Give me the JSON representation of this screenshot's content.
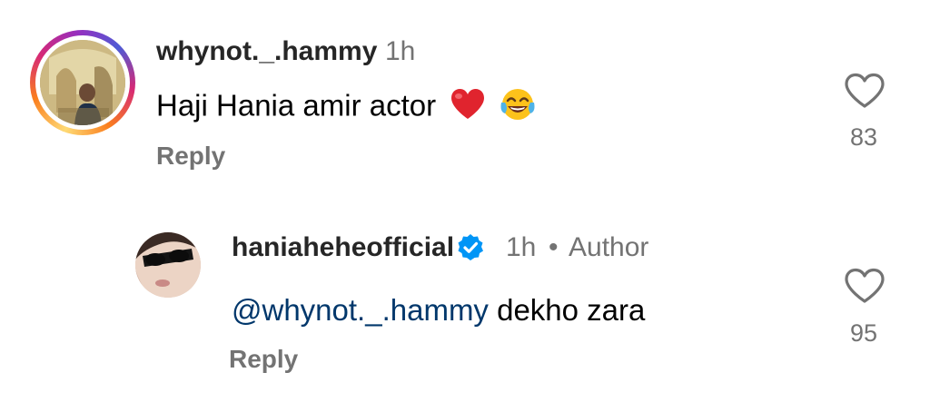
{
  "comments": [
    {
      "username": "whynot._.hammy",
      "time": "1h",
      "text": "Haji Hania amir actor",
      "reply_label": "Reply",
      "likes": "83",
      "emoji": [
        "red-heart",
        "tears-of-joy"
      ]
    }
  ],
  "replies": [
    {
      "username": "haniaheheofficial",
      "verified": true,
      "time": "1h",
      "separator": "•",
      "badge": "Author",
      "mention": "@whynot._.hammy",
      "text": " dekho zara",
      "reply_label": "Reply",
      "likes": "95"
    }
  ],
  "colors": {
    "username": "#262626",
    "meta": "#737373",
    "mention": "#00376b",
    "verified": "#0095f6"
  }
}
